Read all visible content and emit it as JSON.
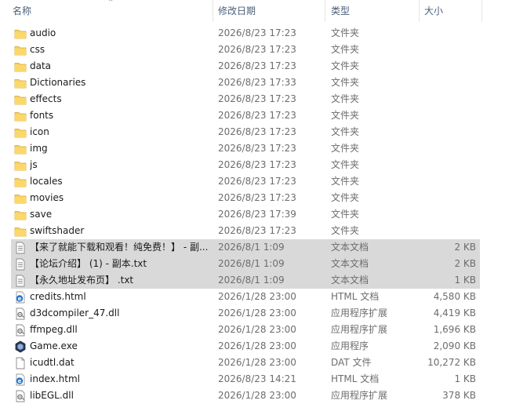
{
  "header": {
    "name": "名称",
    "date": "修改日期",
    "type": "类型",
    "size": "大小"
  },
  "files": [
    {
      "name": "audio",
      "date": "2026/8/23 17:23",
      "type": "文件夹",
      "size": "",
      "icon": "folder"
    },
    {
      "name": "css",
      "date": "2026/8/23 17:23",
      "type": "文件夹",
      "size": "",
      "icon": "folder"
    },
    {
      "name": "data",
      "date": "2026/8/23 17:23",
      "type": "文件夹",
      "size": "",
      "icon": "folder"
    },
    {
      "name": "Dictionaries",
      "date": "2026/8/23 17:33",
      "type": "文件夹",
      "size": "",
      "icon": "folder"
    },
    {
      "name": "effects",
      "date": "2026/8/23 17:23",
      "type": "文件夹",
      "size": "",
      "icon": "folder"
    },
    {
      "name": "fonts",
      "date": "2026/8/23 17:23",
      "type": "文件夹",
      "size": "",
      "icon": "folder"
    },
    {
      "name": "icon",
      "date": "2026/8/23 17:23",
      "type": "文件夹",
      "size": "",
      "icon": "folder"
    },
    {
      "name": "img",
      "date": "2026/8/23 17:23",
      "type": "文件夹",
      "size": "",
      "icon": "folder"
    },
    {
      "name": "js",
      "date": "2026/8/23 17:23",
      "type": "文件夹",
      "size": "",
      "icon": "folder"
    },
    {
      "name": "locales",
      "date": "2026/8/23 17:23",
      "type": "文件夹",
      "size": "",
      "icon": "folder"
    },
    {
      "name": "movies",
      "date": "2026/8/23 17:23",
      "type": "文件夹",
      "size": "",
      "icon": "folder"
    },
    {
      "name": "save",
      "date": "2026/8/23 17:39",
      "type": "文件夹",
      "size": "",
      "icon": "folder"
    },
    {
      "name": "swiftshader",
      "date": "2026/8/23 17:23",
      "type": "文件夹",
      "size": "",
      "icon": "folder"
    },
    {
      "name": "【来了就能下载和观看！纯免费！】 - 副...",
      "date": "2026/8/1 1:09",
      "type": "文本文档",
      "size": "2 KB",
      "icon": "text",
      "selected": true
    },
    {
      "name": "【论坛介绍】 (1) - 副本.txt",
      "date": "2026/8/1 1:09",
      "type": "文本文档",
      "size": "2 KB",
      "icon": "text",
      "selected": true
    },
    {
      "name": "【永久地址发布页】 .txt",
      "date": "2026/8/1 1:09",
      "type": "文本文档",
      "size": "1 KB",
      "icon": "text",
      "selected": true
    },
    {
      "name": "credits.html",
      "date": "2026/1/28 23:00",
      "type": "HTML 文档",
      "size": "4,580 KB",
      "icon": "html"
    },
    {
      "name": "d3dcompiler_47.dll",
      "date": "2026/1/28 23:00",
      "type": "应用程序扩展",
      "size": "4,419 KB",
      "icon": "dll"
    },
    {
      "name": "ffmpeg.dll",
      "date": "2026/1/28 23:00",
      "type": "应用程序扩展",
      "size": "1,696 KB",
      "icon": "dll"
    },
    {
      "name": "Game.exe",
      "date": "2026/1/28 23:00",
      "type": "应用程序",
      "size": "2,090 KB",
      "icon": "exe"
    },
    {
      "name": "icudtl.dat",
      "date": "2026/1/28 23:00",
      "type": "DAT 文件",
      "size": "10,272 KB",
      "icon": "blank"
    },
    {
      "name": "index.html",
      "date": "2026/8/23 14:21",
      "type": "HTML 文档",
      "size": "1 KB",
      "icon": "html"
    },
    {
      "name": "libEGL.dll",
      "date": "2026/1/28 23:00",
      "type": "应用程序扩展",
      "size": "378 KB",
      "icon": "dll"
    }
  ]
}
